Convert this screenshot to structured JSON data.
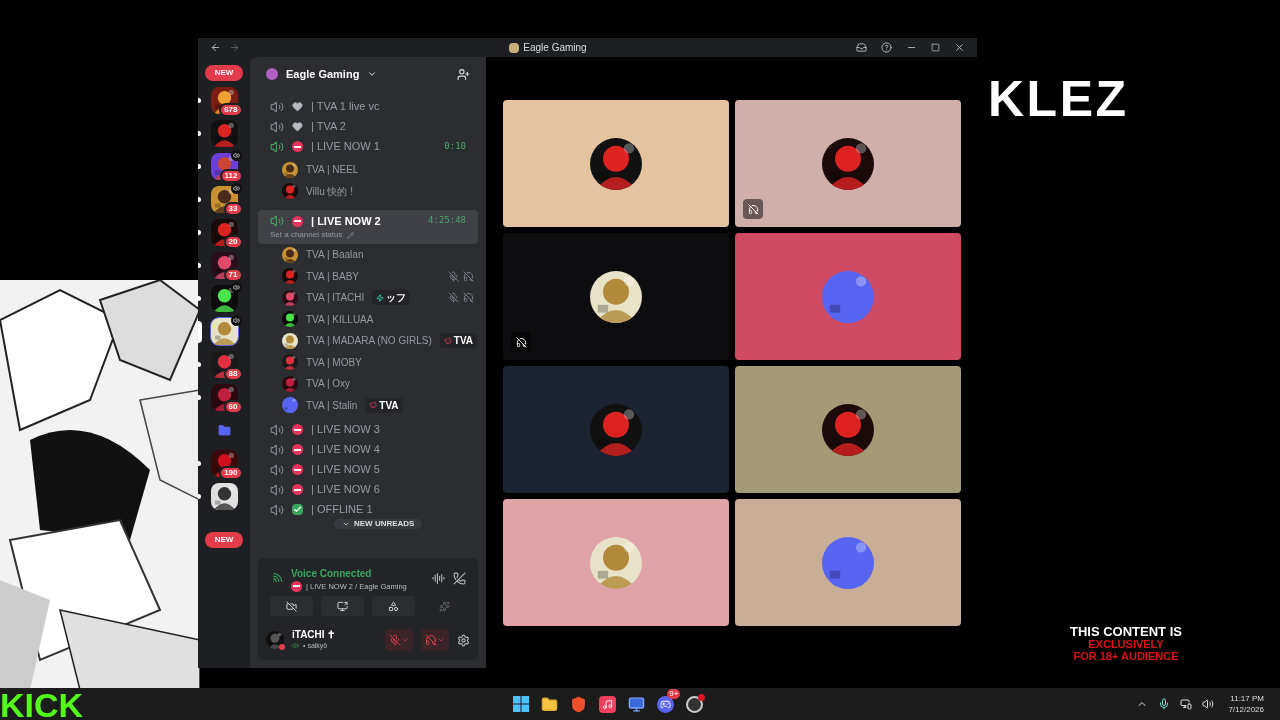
{
  "overlay": {
    "logo_text": "KLEZ",
    "brand": "KICK",
    "notice": [
      "THIS CONTENT IS",
      "EXCLUSIVELY",
      "FOR 18+ AUDIENCE"
    ]
  },
  "window": {
    "title": "Eagle Gaming"
  },
  "servers": {
    "new_top": "NEW",
    "new_bottom": "NEW",
    "items": [
      {
        "kind": "server",
        "selected": false,
        "badge": "678",
        "voice": false
      },
      {
        "kind": "server",
        "selected": false,
        "voice": false
      },
      {
        "kind": "server",
        "selected": false,
        "badge": "112",
        "voice": true
      },
      {
        "kind": "server",
        "selected": false,
        "badge": "33",
        "voice": true
      },
      {
        "kind": "server",
        "selected": false,
        "badge": "20",
        "voice": false
      },
      {
        "kind": "server",
        "selected": false,
        "badge": "71",
        "voice": false
      },
      {
        "kind": "server",
        "selected": false,
        "voice": true
      },
      {
        "kind": "server",
        "selected": true,
        "voice": true
      },
      {
        "kind": "server",
        "selected": false,
        "badge": "88",
        "voice": false
      },
      {
        "kind": "server",
        "selected": false,
        "badge": "60",
        "voice": false
      },
      {
        "kind": "folder",
        "selected": false,
        "voice": false
      },
      {
        "kind": "server",
        "selected": false,
        "badge": "190",
        "voice": false
      },
      {
        "kind": "server",
        "selected": false,
        "voice": false
      }
    ]
  },
  "sidebar": {
    "server_name": "Eagle Gaming",
    "new_unreads": "NEW UNREADS",
    "channels": [
      {
        "name": "| TVA 1 live vc",
        "kind": "heart",
        "active": false,
        "selected": false
      },
      {
        "name": "| TVA 2",
        "kind": "heart",
        "active": false,
        "selected": false
      },
      {
        "name": "| LIVE NOW 1",
        "kind": "blocked",
        "active": true,
        "selected": false,
        "timer": "0:10",
        "members": [
          {
            "name": "TVA | NEEL",
            "muted": false,
            "deafened": false
          },
          {
            "name": "Villu 快的 !",
            "muted": false,
            "deafened": false
          }
        ]
      },
      {
        "name": "| LIVE NOW 2",
        "kind": "blocked",
        "active": true,
        "selected": true,
        "timer": "4:25:48",
        "hint": "Set a channel status",
        "members": [
          {
            "name": "TVA | Baalan",
            "muted": false,
            "deafened": false
          },
          {
            "name": "TVA | BABY",
            "muted": true,
            "deafened": true
          },
          {
            "name": "TVA | ITACHI",
            "muted": true,
            "deafened": true,
            "tag": {
              "kind": "bolt",
              "text": "ッフ"
            }
          },
          {
            "name": "TVA | KILLUAA",
            "muted": false,
            "deafened": false
          },
          {
            "name": "TVA | MADARA (NO GIRLS)",
            "muted": false,
            "deafened": false,
            "tag": {
              "kind": "pig",
              "text": "TVA"
            }
          },
          {
            "name": "TVA | MOBY",
            "muted": false,
            "deafened": false
          },
          {
            "name": "TVA | Oxy",
            "muted": false,
            "deafened": false
          },
          {
            "name": "TVA | Stalin",
            "muted": false,
            "deafened": false,
            "tag": {
              "kind": "pig",
              "text": "TVA"
            }
          }
        ]
      },
      {
        "name": "| LIVE NOW 3",
        "kind": "blocked",
        "active": false,
        "selected": false
      },
      {
        "name": "| LIVE NOW 4",
        "kind": "blocked",
        "active": false,
        "selected": false
      },
      {
        "name": "| LIVE NOW 5",
        "kind": "blocked",
        "active": false,
        "selected": false
      },
      {
        "name": "| LIVE NOW 6",
        "kind": "blocked",
        "active": false,
        "selected": false
      },
      {
        "name": "| OFFLINE 1",
        "kind": "done",
        "active": false,
        "selected": false
      }
    ]
  },
  "voice_panel": {
    "title": "Voice Connected",
    "channel": "| LIVE NOW 2 / Eagle Gaming"
  },
  "user": {
    "name": "iTACHI ✝",
    "status": "• saikyō",
    "mic_muted": true,
    "deafened": true
  },
  "video_tiles": [
    {
      "color": "#e4c3a0",
      "deafened": false
    },
    {
      "color": "#d0afaa",
      "deafened": true
    },
    {
      "color": "#0d0d10",
      "deafened": true
    },
    {
      "color": "#cf4a63",
      "deafened": false
    },
    {
      "color": "#1c2331",
      "deafened": false
    },
    {
      "color": "#a39a76",
      "deafened": false
    },
    {
      "color": "#dea2a7",
      "deafened": false
    },
    {
      "color": "#c7ae95",
      "deafened": false
    }
  ],
  "taskbar": {
    "discord_badge": "9+",
    "time": "11:17 PM",
    "date": "7/12/2026"
  }
}
